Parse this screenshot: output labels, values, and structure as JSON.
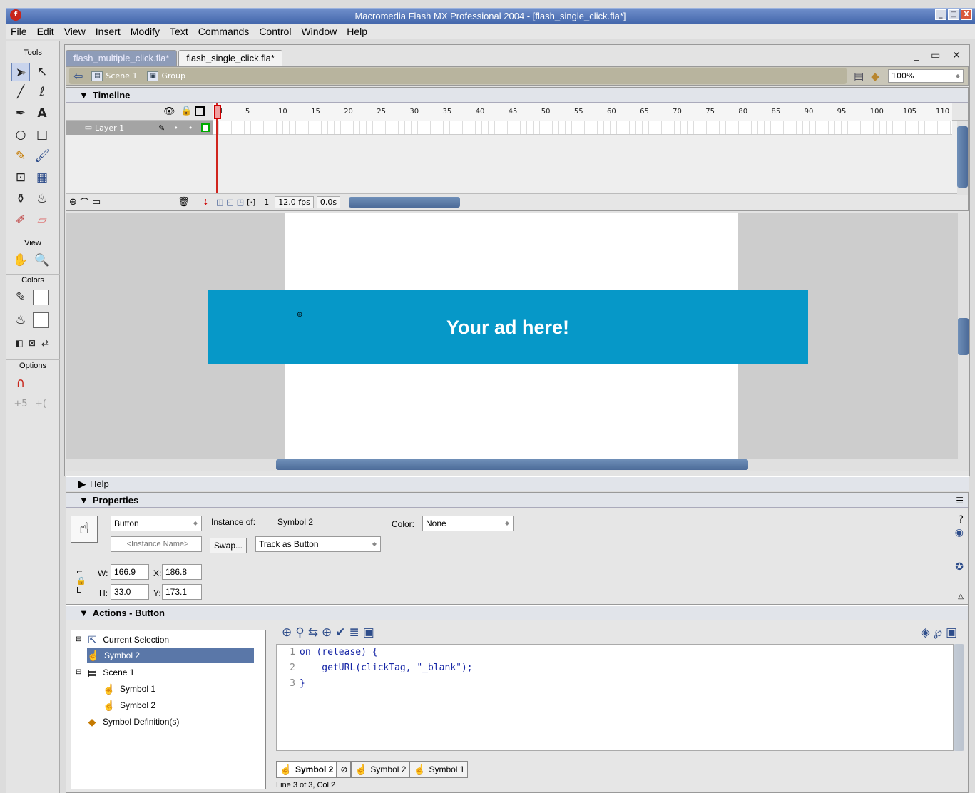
{
  "window": {
    "title": "Macromedia Flash MX Professional 2004 - [flash_single_click.fla*]"
  },
  "menu": [
    "File",
    "Edit",
    "View",
    "Insert",
    "Modify",
    "Text",
    "Commands",
    "Control",
    "Window",
    "Help"
  ],
  "tools": {
    "header": "Tools",
    "view_header": "View",
    "colors_header": "Colors",
    "options_header": "Options"
  },
  "tabs": [
    {
      "label": "flash_multiple_click.fla*",
      "active": false
    },
    {
      "label": "flash_single_click.fla*",
      "active": true
    }
  ],
  "editbar": {
    "scene": "Scene 1",
    "group": "Group",
    "zoom": "100%"
  },
  "timeline": {
    "header": "Timeline",
    "layer": "Layer 1",
    "ticks": [
      "1",
      "5",
      "10",
      "15",
      "20",
      "25",
      "30",
      "35",
      "40",
      "45",
      "50",
      "55",
      "60",
      "65",
      "70",
      "75",
      "80",
      "85",
      "90",
      "95",
      "100",
      "105",
      "110"
    ],
    "current_frame": "1",
    "fps": "12.0 fps",
    "elapsed": "0.0s"
  },
  "stage": {
    "banner_text": "Your ad here!",
    "banner_color": "#0698c8"
  },
  "help": {
    "header": "Help"
  },
  "properties": {
    "header": "Properties",
    "type": "Button",
    "instance_placeholder": "<Instance Name>",
    "instance_of_label": "Instance of:",
    "instance_of": "Symbol 2",
    "swap_label": "Swap...",
    "track": "Track as Button",
    "color_label": "Color:",
    "color": "None",
    "w_label": "W:",
    "w": "166.9",
    "h_label": "H:",
    "h": "33.0",
    "x_label": "X:",
    "x": "186.8",
    "y_label": "Y:",
    "y": "173.1"
  },
  "actions": {
    "header": "Actions - Button",
    "tree": [
      {
        "label": "Current Selection"
      },
      {
        "label": "Symbol 2",
        "selected": true
      },
      {
        "label": "Scene 1"
      },
      {
        "label": "Symbol 1"
      },
      {
        "label": "Symbol 2"
      },
      {
        "label": "Symbol Definition(s)"
      }
    ],
    "code": [
      {
        "num": "1",
        "text": "on (release) {"
      },
      {
        "num": "2",
        "text": "    getURL(clickTag, \"_blank\");"
      },
      {
        "num": "3",
        "text": "}"
      }
    ],
    "script_tabs": [
      "Symbol 2",
      "Symbol 2",
      "Symbol 1"
    ],
    "status": "Line 3 of 3, Col 2"
  }
}
